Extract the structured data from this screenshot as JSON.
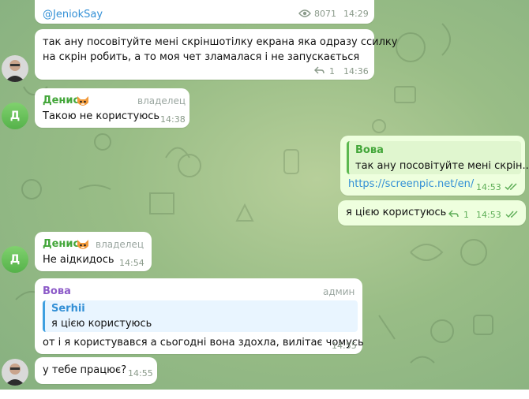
{
  "messages": {
    "m0": {
      "link_text": "@JeniokSay",
      "views": "8071",
      "time": "14:29"
    },
    "m1": {
      "line1": "так ану посовітуйте мені скріншотілку екрана яка одразу ссилку",
      "line2": "на скрін робить, а то моя чет зламалася і не запускається",
      "replies": "1",
      "time": "14:36"
    },
    "m2": {
      "sender": "Денис",
      "role": "владелец",
      "text": "Такою не користуюсь",
      "time": "14:38"
    },
    "m3": {
      "quote_sender": "Вова",
      "quote_text": "так ану посовітуйте мені скрін...",
      "link": "https://screenpic.net/en/",
      "time": "14:53"
    },
    "m4": {
      "text": "я цією користуюсь",
      "replies": "1",
      "time": "14:53"
    },
    "m5": {
      "sender": "Денис",
      "role": "владелец",
      "text": "Не аідкидось",
      "time": "14:54"
    },
    "m6": {
      "sender": "Вова",
      "role": "админ",
      "quote_sender": "Serhii",
      "quote_text": "я цією користуюсь",
      "text": "от і я користувався а сьогодні вона здохла, вилітає чомусь",
      "time": "14:55"
    },
    "m7": {
      "text": "у тебе працює?",
      "time": "14:55"
    }
  },
  "avatars": {
    "denis_letter": "Д"
  },
  "icons": {
    "views": "eye-icon",
    "reply": "reply-arrow-icon",
    "read": "double-check-icon",
    "denis_badge": "fox-emoji-icon"
  },
  "colors": {
    "name_denis": "#43a63a",
    "name_vova_reply": "#43a63a",
    "name_vova": "#8c5ac8",
    "name_serhii": "#3390d6",
    "link": "#3390d6",
    "read_ticks": "#5fae58"
  }
}
